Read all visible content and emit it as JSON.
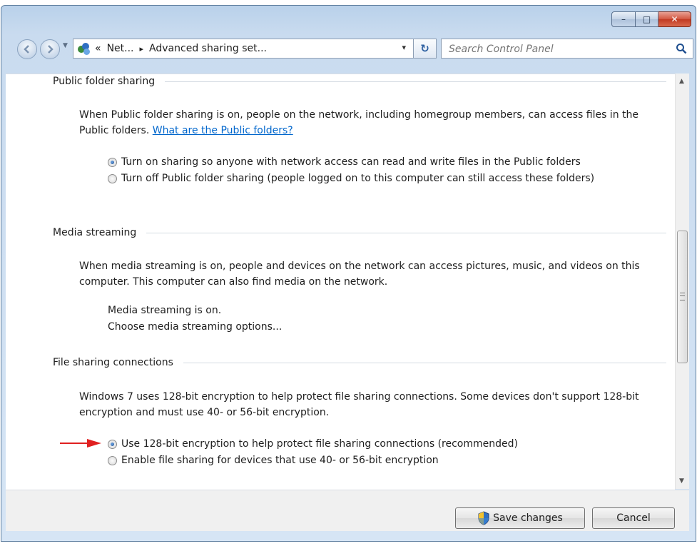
{
  "window": {
    "caption_buttons": {
      "minimize": "–",
      "maximize": "□",
      "close": "✕"
    }
  },
  "nav": {
    "address_chevron": "«",
    "address_segments": [
      "Net...",
      "Advanced sharing set..."
    ],
    "segment_separator": "▸",
    "dropdown_arrow": "▾",
    "refresh_glyph": "↻",
    "search_placeholder": "Search Control Panel"
  },
  "sections": {
    "public_folder": {
      "title": "Public folder sharing",
      "description": "When Public folder sharing is on, people on the network, including homegroup members, can access files in the Public folders.",
      "link": "What are the Public folders?",
      "options": [
        {
          "label": "Turn on sharing so anyone with network access can read and write files in the Public folders",
          "selected": true
        },
        {
          "label": "Turn off Public folder sharing (people logged on to this computer can still access these folders)",
          "selected": false
        }
      ]
    },
    "media_streaming": {
      "title": "Media streaming",
      "description": "When media streaming is on, people and devices on the network can access pictures, music, and videos on this computer. This computer can also find media on the network.",
      "status": "Media streaming is on.",
      "link": "Choose media streaming options..."
    },
    "file_sharing": {
      "title": "File sharing connections",
      "description": "Windows 7 uses 128-bit encryption to help protect file sharing connections. Some devices don't support 128-bit encryption and must use 40- or 56-bit encryption.",
      "options": [
        {
          "label": "Use 128-bit encryption to help protect file sharing connections (recommended)",
          "selected": true
        },
        {
          "label": "Enable file sharing for devices that use 40- or 56-bit encryption",
          "selected": false
        }
      ]
    }
  },
  "footer": {
    "save_label": "Save changes",
    "cancel_label": "Cancel"
  },
  "colors": {
    "annotation_arrow": "#e02020",
    "link": "#0066cc",
    "accent": "#2f6fc2"
  }
}
